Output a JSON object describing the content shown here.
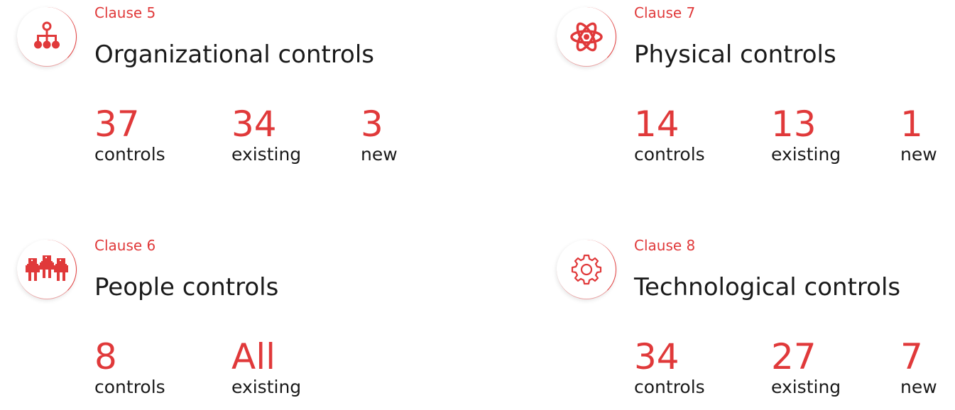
{
  "accent_color": "#e0393a",
  "clauses": [
    {
      "clause_label": "Clause 5",
      "title": "Organizational controls",
      "icon": "org-chart-icon",
      "stats": [
        {
          "value": "37",
          "label": "controls"
        },
        {
          "value": "34",
          "label": "existing"
        },
        {
          "value": "3",
          "label": "new"
        }
      ]
    },
    {
      "clause_label": "Clause 7",
      "title": "Physical controls",
      "icon": "atom-icon",
      "stats": [
        {
          "value": "14",
          "label": "controls"
        },
        {
          "value": "13",
          "label": "existing"
        },
        {
          "value": "1",
          "label": "new"
        }
      ]
    },
    {
      "clause_label": "Clause 6",
      "title": "People controls",
      "icon": "people-icon",
      "stats": [
        {
          "value": "8",
          "label": "controls"
        },
        {
          "value": "All",
          "label": "existing"
        }
      ]
    },
    {
      "clause_label": "Clause 8",
      "title": "Technological controls",
      "icon": "gear-icon",
      "stats": [
        {
          "value": "34",
          "label": "controls"
        },
        {
          "value": "27",
          "label": "existing"
        },
        {
          "value": "7",
          "label": "new"
        }
      ]
    }
  ]
}
